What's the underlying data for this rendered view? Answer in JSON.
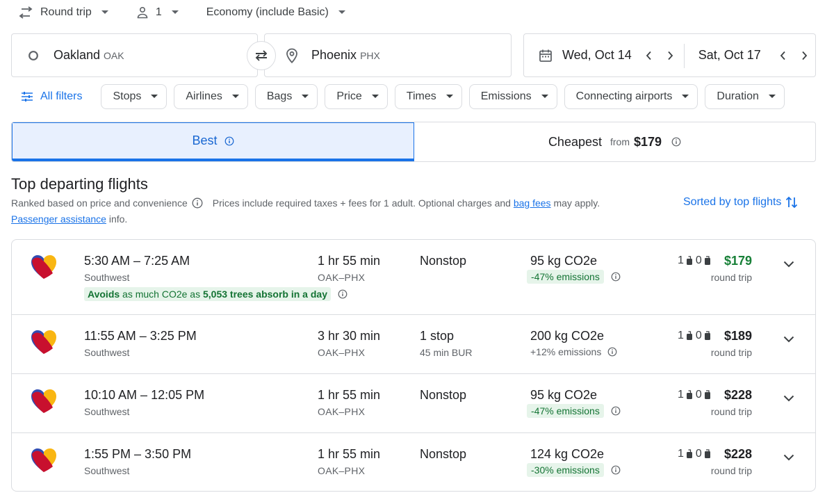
{
  "top_bar": {
    "trip_type": "Round trip",
    "passengers": "1",
    "cabin": "Economy (include Basic)"
  },
  "search": {
    "origin_city": "Oakland",
    "origin_code": "OAK",
    "dest_city": "Phoenix",
    "dest_code": "PHX",
    "depart_date": "Wed, Oct 14",
    "return_date": "Sat, Oct 17"
  },
  "filters": {
    "all_filters": "All filters",
    "chips": [
      "Stops",
      "Airlines",
      "Bags",
      "Price",
      "Times",
      "Emissions",
      "Connecting airports",
      "Duration"
    ]
  },
  "tabs": {
    "best": "Best",
    "cheapest": "Cheapest",
    "from": "from",
    "cheapest_price": "$179"
  },
  "results": {
    "heading": "Top departing flights",
    "ranked": "Ranked based on price and convenience",
    "prices_note": "Prices include required taxes + fees for 1 adult. Optional charges and",
    "bag_fees": "bag fees",
    "may_apply": "may apply.",
    "passenger_assist": "Passenger assistance",
    "info": "info.",
    "sorted": "Sorted by top flights"
  },
  "flights": [
    {
      "times": "5:30 AM – 7:25 AM",
      "airline": "Southwest",
      "duration": "1 hr 55 min",
      "route": "OAK–PHX",
      "stops": "Nonstop",
      "layover": "",
      "co2": "95 kg CO2e",
      "emissions": "-47% emissions",
      "carry_on": "1",
      "checked": "0",
      "price": "$179",
      "price_type": "round trip",
      "avoid_prefix": "Avoids",
      "avoid_middle": "as much CO2e as",
      "avoid_trees": "5,053 trees absorb in a day"
    },
    {
      "times": "11:55 AM – 3:25 PM",
      "airline": "Southwest",
      "duration": "3 hr 30 min",
      "route": "OAK–PHX",
      "stops": "1 stop",
      "layover": "45 min BUR",
      "co2": "200 kg CO2e",
      "emissions": "+12% emissions",
      "carry_on": "1",
      "checked": "0",
      "price": "$189",
      "price_type": "round trip"
    },
    {
      "times": "10:10 AM – 12:05 PM",
      "airline": "Southwest",
      "duration": "1 hr 55 min",
      "route": "OAK–PHX",
      "stops": "Nonstop",
      "layover": "",
      "co2": "95 kg CO2e",
      "emissions": "-47% emissions",
      "carry_on": "1",
      "checked": "0",
      "price": "$228",
      "price_type": "round trip"
    },
    {
      "times": "1:55 PM – 3:50 PM",
      "airline": "Southwest",
      "duration": "1 hr 55 min",
      "route": "OAK–PHX",
      "stops": "Nonstop",
      "layover": "",
      "co2": "124 kg CO2e",
      "emissions": "-30% emissions",
      "carry_on": "1",
      "checked": "0",
      "price": "$228",
      "price_type": "round trip"
    }
  ],
  "colors": {
    "accent": "#1a73e8",
    "selected_tab_bg": "#e8f0fe",
    "green_price": "#188038",
    "emission_badge_bg": "#e6f4ea",
    "emission_badge_text": "#137333"
  },
  "icons": {
    "trip_type": "swap-arrows-icon",
    "passengers": "person-icon",
    "origin": "circle-origin-icon",
    "swap": "swap-icon",
    "destination": "location-pin-icon",
    "calendar": "calendar-icon",
    "filters": "tune-icon",
    "info": "info-icon",
    "sort": "sort-arrows-icon",
    "carry_on": "carry-on-bag-icon",
    "checked_bag": "checked-bag-icon",
    "expand": "chevron-down-icon",
    "airline_logo": "southwest-heart-logo"
  }
}
